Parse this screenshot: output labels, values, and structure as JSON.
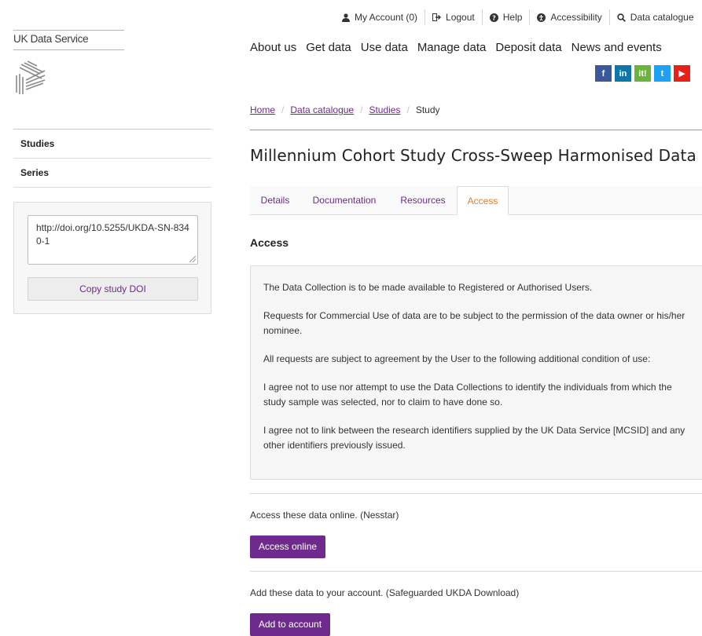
{
  "brand": {
    "name": "UK Data Service"
  },
  "utility": {
    "account": "My Account (0)",
    "logout": "Logout",
    "help": "Help",
    "accessibility": "Accessibility",
    "catalogue": "Data catalogue"
  },
  "nav": [
    "About us",
    "Get data",
    "Use data",
    "Manage data",
    "Deposit data",
    "News and events"
  ],
  "social": {
    "facebook": "f",
    "linkedin": "in",
    "jiscmail": "it!",
    "twitter": "t",
    "youtube": "▶",
    "colors": {
      "facebook": "#3b5998",
      "linkedin": "#0e76a8",
      "jiscmail": "#6cb33e",
      "twitter": "#1da1f2",
      "youtube": "#e62117"
    }
  },
  "sidebar": {
    "items": [
      "Studies",
      "Series"
    ],
    "doi_text": "http://doi.org/10.5255/UKDA-SN-8340-1",
    "copy_label": "Copy study DOI"
  },
  "breadcrumb": {
    "home": "Home",
    "catalogue": "Data catalogue",
    "studies": "Studies",
    "current": "Study",
    "sep": "/"
  },
  "title": "Millennium Cohort Study Cross-Sweep Harmonised Data",
  "tabs": [
    {
      "label": "Details",
      "active": false
    },
    {
      "label": "Documentation",
      "active": false
    },
    {
      "label": "Resources",
      "active": false
    },
    {
      "label": "Access",
      "active": true
    }
  ],
  "access": {
    "heading": "Access",
    "paragraphs": [
      "The Data Collection is to be made available to Registered or Authorised Users.",
      "Requests for Commercial Use of data are to be subject to the permission of the data owner or his/her nominee.",
      "All requests are subject to agreement by the User to the following additional condition of use:",
      "I agree not to use nor attempt to use the Data Collections to identify the individuals from which the study sample was selected, nor to claim to have done so.",
      "I agree not to link between the research identifiers supplied by the UK Data Service [MCSID] and any other identifiers previously issued."
    ],
    "online_note": "Access these data online. (Nesstar)",
    "online_button": "Access online",
    "download_note": "Add these data to your account. (Safeguarded UKDA Download)",
    "download_button": "Add to account"
  },
  "colors": {
    "accent": "#6e2a8c",
    "active_tab": "#e07d2c"
  }
}
